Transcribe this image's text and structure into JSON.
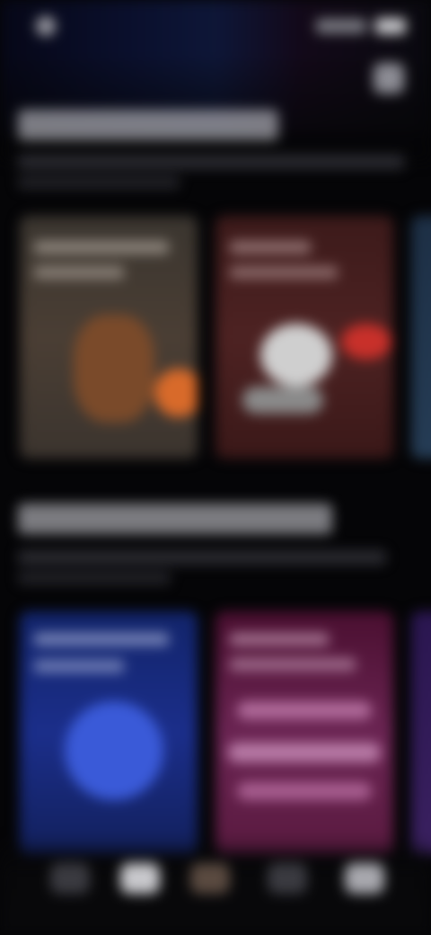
{
  "status_bar": {
    "time": "",
    "battery_icon": "battery-icon",
    "signal_icon": "signal-icon"
  },
  "header": {
    "title": "",
    "action_icon": "profile-icon"
  },
  "sections": [
    {
      "title": "",
      "subtitle": "",
      "cards": [
        {
          "title": ""
        },
        {
          "title": ""
        },
        {
          "title": ""
        }
      ]
    },
    {
      "title": "",
      "subtitle": "",
      "cards": [
        {
          "title": ""
        },
        {
          "title": ""
        },
        {
          "title": ""
        }
      ]
    }
  ],
  "tabbar": {
    "tabs": [
      {
        "icon": "home-icon",
        "label": ""
      },
      {
        "icon": "browse-icon",
        "label": ""
      },
      {
        "icon": "now-playing-icon",
        "label": ""
      },
      {
        "icon": "radio-icon",
        "label": ""
      },
      {
        "icon": "library-icon",
        "label": ""
      }
    ]
  },
  "colors": {
    "background": "#050507",
    "card_1": "#4a3e34",
    "card_2": "#4d2222",
    "card_4": "#1b2e8a",
    "card_5": "#6a2452",
    "accent_orange": "#d86a2a",
    "accent_red": "#c8302a"
  }
}
